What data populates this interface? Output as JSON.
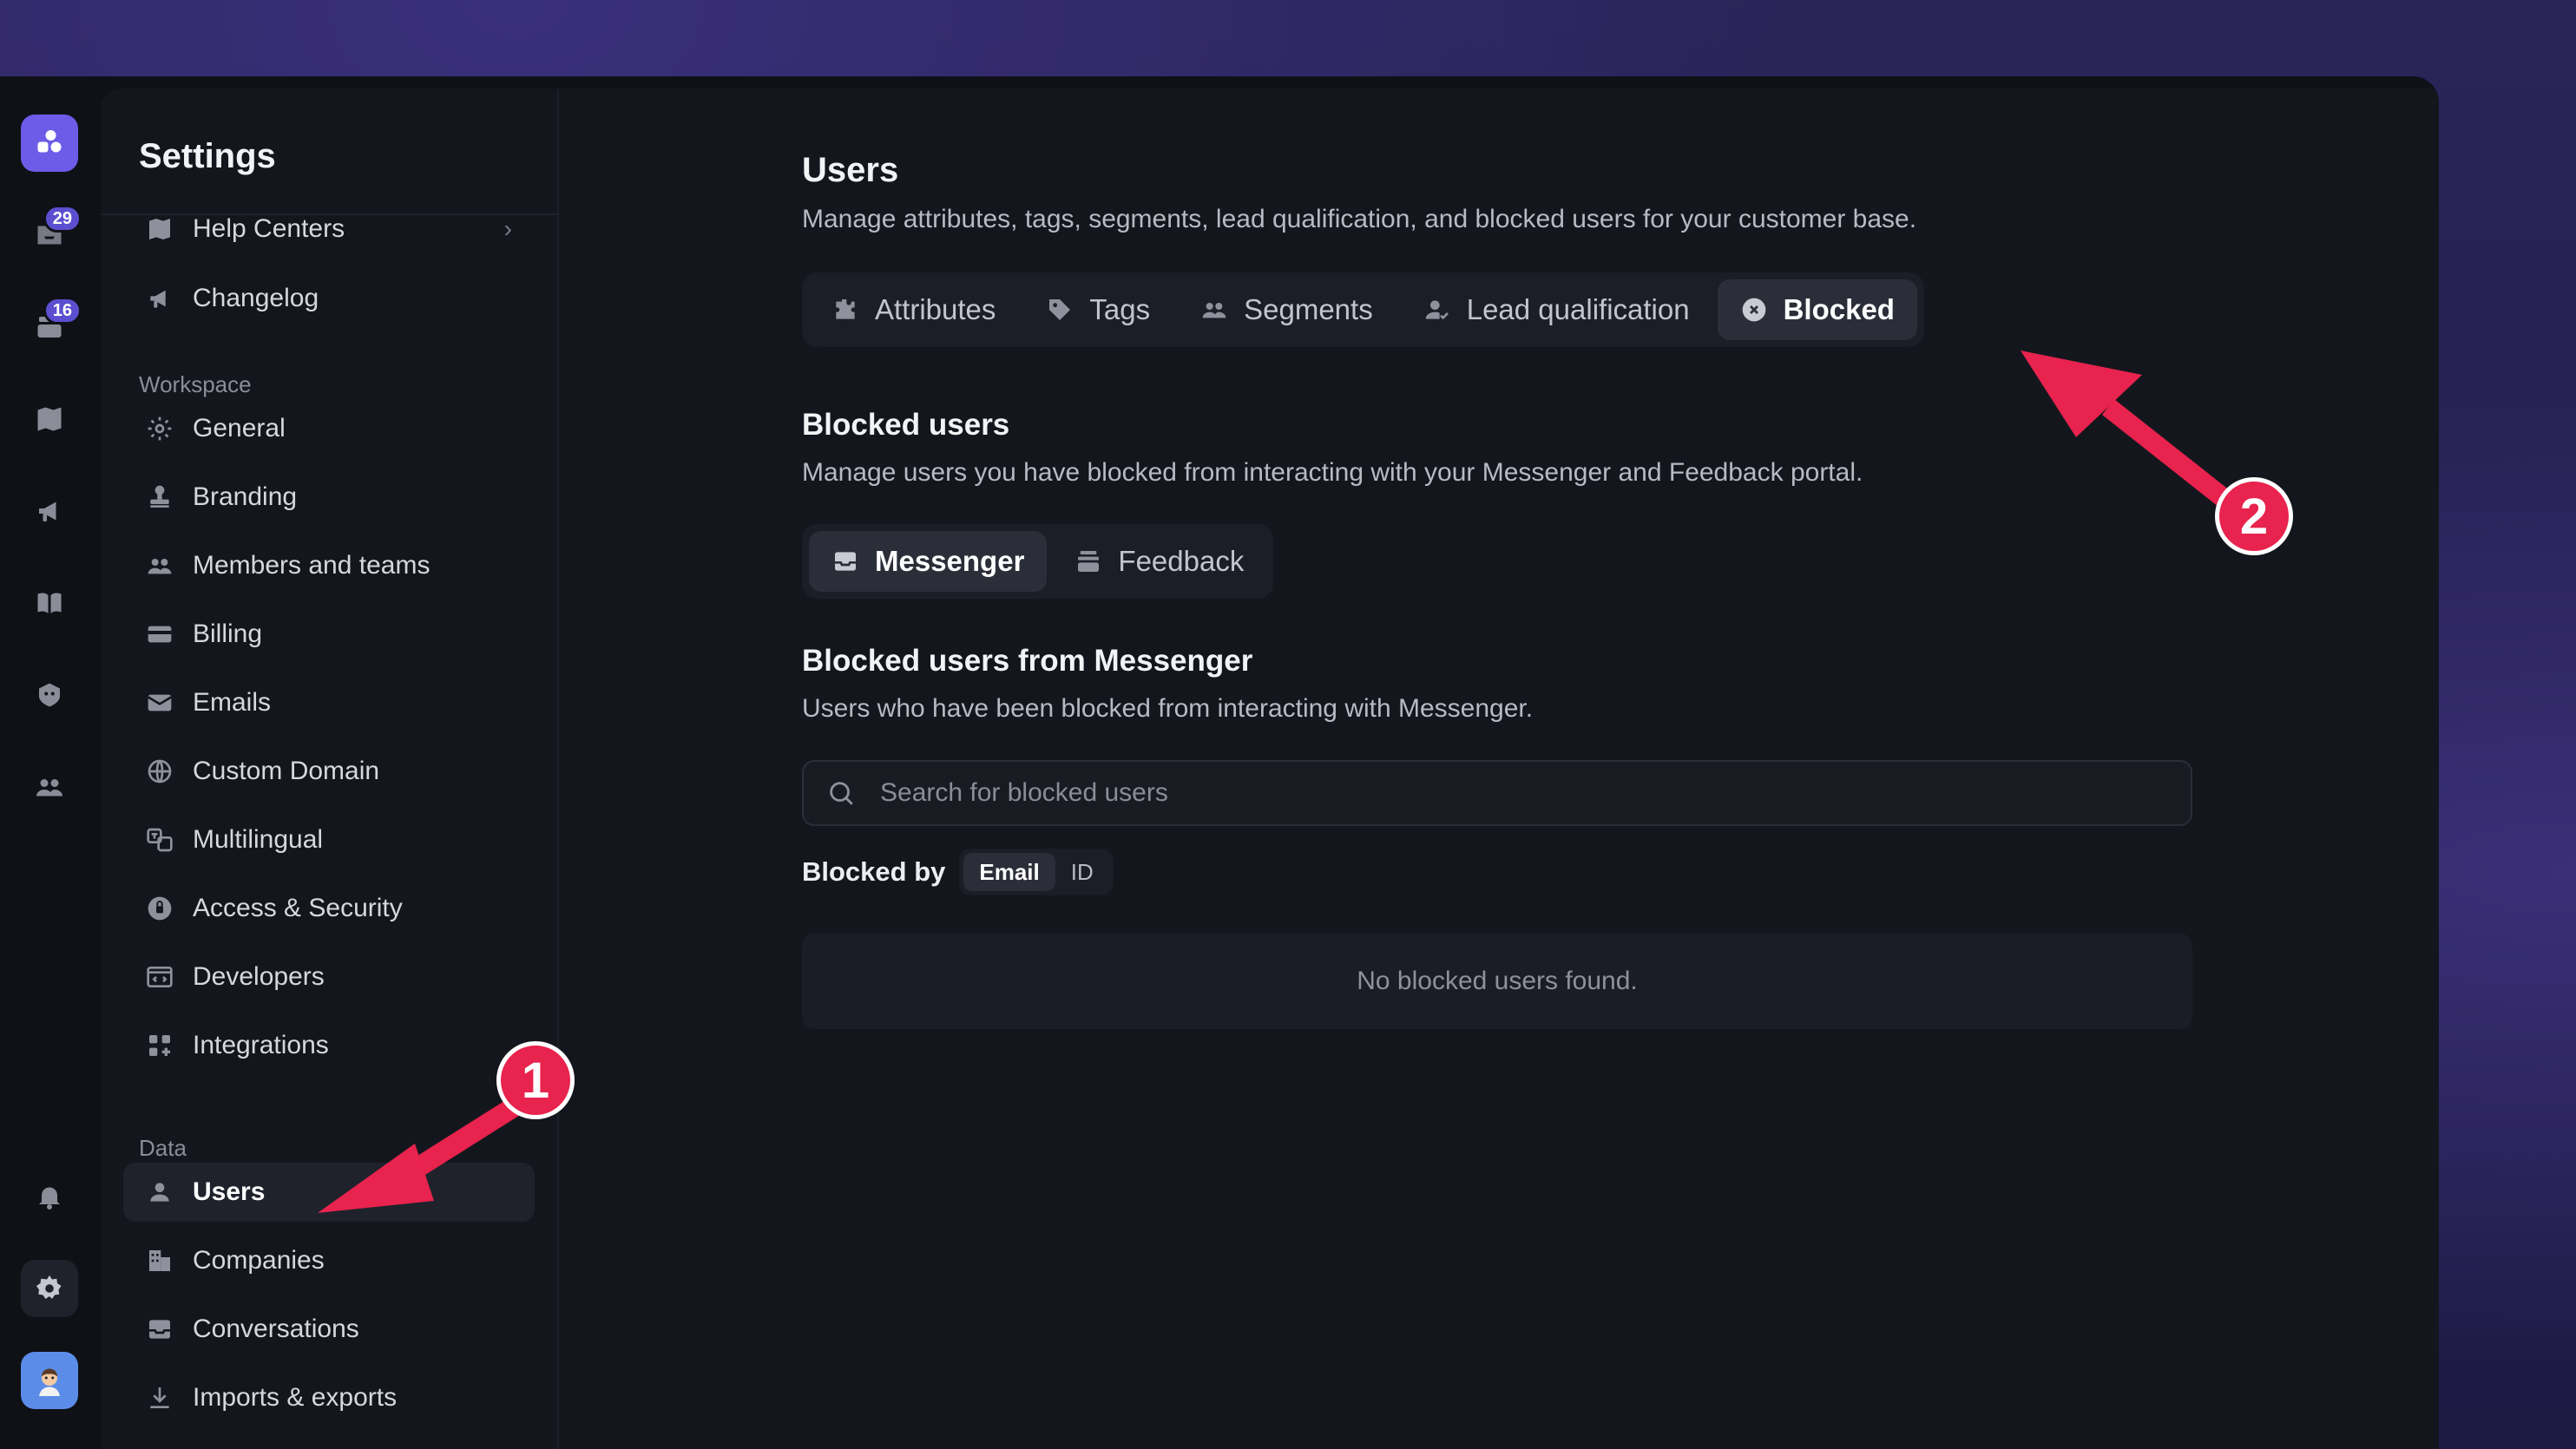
{
  "rail": {
    "badges": {
      "inbox": "29",
      "tickets": "16"
    }
  },
  "sidebar": {
    "title": "Settings",
    "top_items": [
      {
        "label": "Help Centers"
      },
      {
        "label": "Changelog"
      }
    ],
    "section_workspace": "Workspace",
    "workspace_items": [
      {
        "label": "General"
      },
      {
        "label": "Branding"
      },
      {
        "label": "Members and teams"
      },
      {
        "label": "Billing"
      },
      {
        "label": "Emails"
      },
      {
        "label": "Custom Domain"
      },
      {
        "label": "Multilingual"
      },
      {
        "label": "Access & Security"
      },
      {
        "label": "Developers"
      },
      {
        "label": "Integrations"
      }
    ],
    "section_data": "Data",
    "data_items": [
      {
        "label": "Users"
      },
      {
        "label": "Companies"
      },
      {
        "label": "Conversations"
      },
      {
        "label": "Imports & exports"
      }
    ]
  },
  "main": {
    "title": "Users",
    "description": "Manage attributes, tags, segments, lead qualification, and blocked users for your customer base.",
    "tabs": [
      {
        "label": "Attributes"
      },
      {
        "label": "Tags"
      },
      {
        "label": "Segments"
      },
      {
        "label": "Lead qualification"
      },
      {
        "label": "Blocked"
      }
    ],
    "blocked_title": "Blocked users",
    "blocked_desc": "Manage users you have blocked from interacting with your Messenger and Feedback portal.",
    "subtabs": [
      {
        "label": "Messenger"
      },
      {
        "label": "Feedback"
      }
    ],
    "messenger_title": "Blocked users from Messenger",
    "messenger_desc": "Users who have been blocked from interacting with Messenger.",
    "search_placeholder": "Search for blocked users",
    "blocked_by_label": "Blocked by",
    "blocked_by_options": [
      {
        "label": "Email"
      },
      {
        "label": "ID"
      }
    ],
    "empty_text": "No blocked users found."
  },
  "annotations": {
    "step1": "1",
    "step2": "2",
    "color": "#e8234d"
  }
}
